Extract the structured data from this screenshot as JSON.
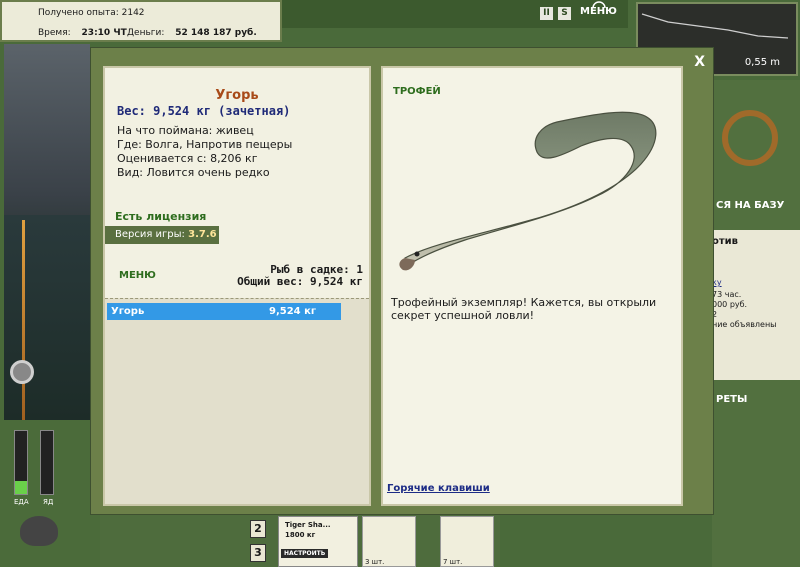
{
  "hud": {
    "exp_label": "Получено опыта:",
    "exp_value": "2142",
    "time_label": "Время:",
    "time_value": "23:10 ЧТ",
    "money_label": "Деньги:",
    "money_value": "52 148 187 руб.",
    "pause_icon_glyph": "II",
    "sound_icon_glyph": "S",
    "menu_label": "МЕНЮ",
    "depth_value": "0,55 m"
  },
  "background_right": {
    "base_text": "ся на базу",
    "against_text": "отив",
    "link_text": "ку",
    "hours": "73 час.",
    "rub": "000 руб.",
    "num2": "2",
    "ads": "ние объявлены",
    "secrets": "реты"
  },
  "left_gauges": {
    "food_label": "ЕДА",
    "poison_label": "ЯД"
  },
  "bottom_bar": {
    "slot2": "2",
    "slot3": "3",
    "lure_name": "Tiger Sha...",
    "lure_weight": "1800 кг",
    "lure_button": "НАСТРОИТЬ",
    "slot_count_1": "3 шт.",
    "slot_count_2": "7 шт."
  },
  "dialog": {
    "close_label": "X",
    "fish": {
      "name": "Угорь",
      "weight": "Вес: 9,524 кг (зачетная)",
      "bait": "На что поймана: живец",
      "where": "Где: Волга, Напротив пещеры",
      "estimated": "Оценивается с: 8,206 кг",
      "kind": "Вид: Ловится очень редко"
    },
    "license": "Есть лицензия",
    "version_label": "Версия игры:",
    "version_value": "3.7.6",
    "menu_link": "МЕНЮ",
    "catch_count": "Рыб в садке: 1",
    "catch_total": "Общий вес: 9,524 кг",
    "catch_list": [
      {
        "name": "Угорь",
        "weight": "9,524 кг"
      }
    ],
    "trophy_title": "ТРОФЕЙ",
    "trophy_text": "Трофейный экземпляр! Кажется, вы открыли секрет успешной ловли!",
    "hotkeys": "Горячие клавиши"
  },
  "colors": {
    "dialog_frame": "#6c8049",
    "selected_row": "#3399e6",
    "fish_name": "#a84a18",
    "fish_weight": "#1f2a78"
  }
}
